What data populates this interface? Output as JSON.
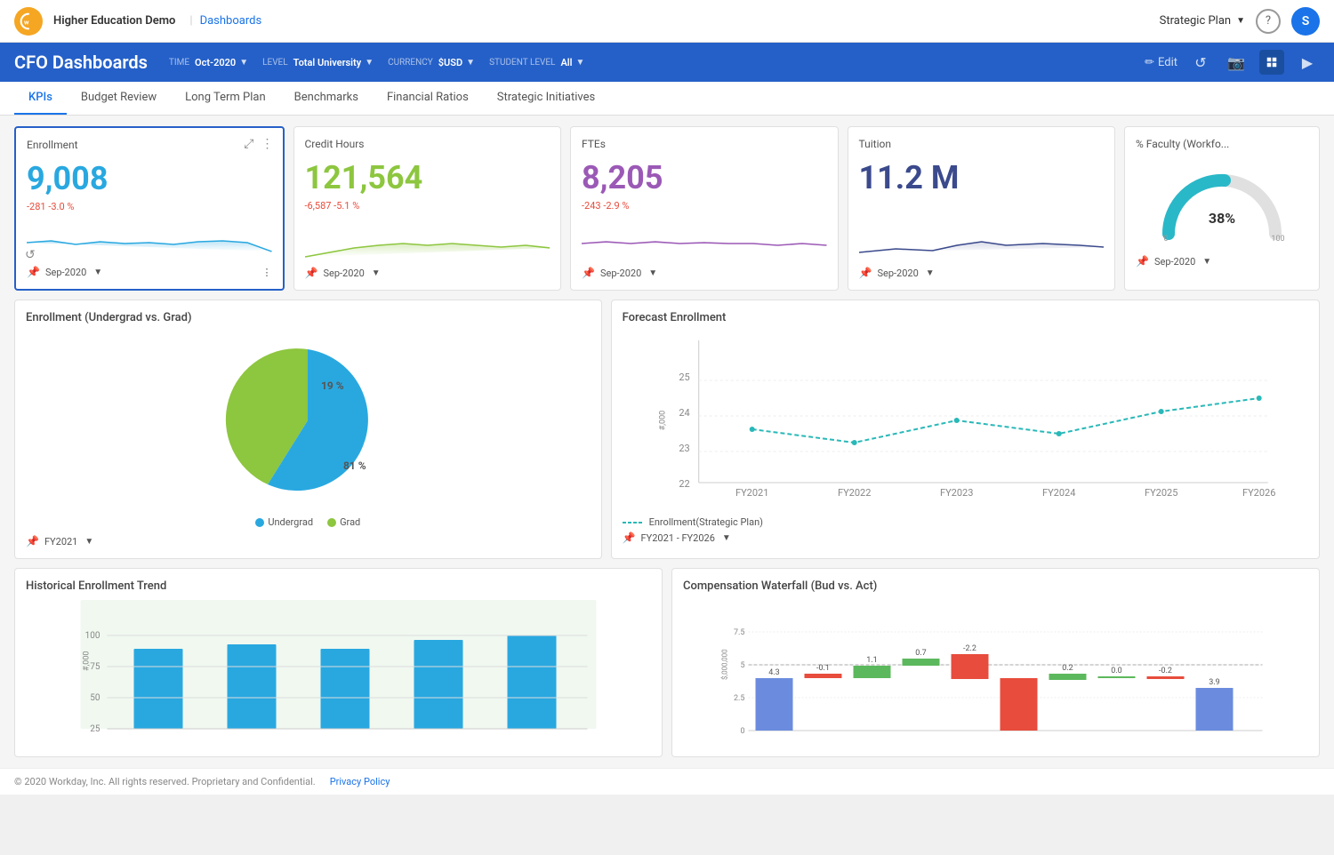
{
  "app": {
    "logo_letter": "W",
    "app_name": "Higher Education Demo",
    "separator": "|",
    "nav_link": "Dashboards",
    "strategic_plan_label": "Strategic Plan",
    "help_icon": "?",
    "avatar_letter": "S"
  },
  "header": {
    "title": "CFO Dashboards",
    "filters": [
      {
        "label": "TIME",
        "value": "Oct-2020",
        "id": "time-filter"
      },
      {
        "label": "LEVEL",
        "value": "Total University",
        "id": "level-filter"
      },
      {
        "label": "CURRENCY",
        "value": "$USD",
        "id": "currency-filter"
      },
      {
        "label": "STUDENT LEVEL",
        "value": "All",
        "id": "student-filter"
      }
    ],
    "edit_label": "Edit",
    "refresh_icon": "↺",
    "camera_icon": "📷",
    "grid_icon": "⊞",
    "video_icon": "▶"
  },
  "tabs": [
    {
      "label": "KPIs",
      "active": true
    },
    {
      "label": "Budget Review",
      "active": false
    },
    {
      "label": "Long Term Plan",
      "active": false
    },
    {
      "label": "Benchmarks",
      "active": false
    },
    {
      "label": "Financial Ratios",
      "active": false
    },
    {
      "label": "Strategic Initiatives",
      "active": false
    }
  ],
  "kpis": [
    {
      "title": "Enrollment",
      "value": "9,008",
      "value_color": "blue",
      "delta": "-281  -3.0 %",
      "footer_pin": "Sep-2020",
      "sparkline_color": "#29a8e0",
      "sparkline_fill": "rgba(41,168,224,0.1)"
    },
    {
      "title": "Credit Hours",
      "value": "121,564",
      "value_color": "green",
      "delta": "-6,587  -5.1 %",
      "footer_pin": "Sep-2020",
      "sparkline_color": "#8dc63f",
      "sparkline_fill": "rgba(141,198,63,0.1)"
    },
    {
      "title": "FTEs",
      "value": "8,205",
      "value_color": "purple",
      "delta": "-243  -2.9 %",
      "footer_pin": "Sep-2020",
      "sparkline_color": "#9b59b6",
      "sparkline_fill": "rgba(155,89,182,0.1)"
    },
    {
      "title": "Tuition",
      "value": "11.2 M",
      "value_color": "dark-blue",
      "delta": "",
      "footer_pin": "Sep-2020",
      "sparkline_color": "#3b4a8c",
      "sparkline_fill": "rgba(59,74,140,0.1)"
    },
    {
      "title": "% Faculty (Workfo...",
      "value": "",
      "value_color": "",
      "delta": "",
      "footer_pin": "Sep-2020",
      "gauge_pct": 38,
      "gauge_min": 0,
      "gauge_max": 100
    }
  ],
  "enrollment_pie": {
    "title": "Enrollment (Undergrad vs. Grad)",
    "undergrad_pct": 81,
    "grad_pct": 19,
    "undergrad_color": "#29a8e0",
    "grad_color": "#8dc63f",
    "undergrad_label": "Undergrad",
    "grad_label": "Grad",
    "footer_pin": "FY2021"
  },
  "forecast_enrollment": {
    "title": "Forecast Enrollment",
    "y_axis_labels": [
      "22",
      "23",
      "24",
      "25"
    ],
    "x_axis_labels": [
      "FY2021",
      "FY2022",
      "FY2023",
      "FY2024",
      "FY2025",
      "FY2026"
    ],
    "y_axis_unit": "#,000",
    "legend_label": "Enrollment(Strategic Plan)",
    "footer_pin": "FY2021 - FY2026",
    "line_color": "#29b8b8"
  },
  "historical_enrollment": {
    "title": "Historical Enrollment Trend",
    "y_axis_labels": [
      "25",
      "50",
      "75",
      "100"
    ],
    "y_axis_unit": "#,000",
    "bar_color": "#29a8e0",
    "bg_color": "#f0f8f0"
  },
  "compensation_waterfall": {
    "title": "Compensation Waterfall (Bud vs. Act)",
    "y_axis_labels": [
      "0",
      "2.5",
      "5",
      "7.5"
    ],
    "y_axis_unit": "$,000,000",
    "bars": [
      {
        "label": "",
        "value": 4.3,
        "color": "#6b8cde",
        "type": "base"
      },
      {
        "label": "",
        "value": -0.1,
        "color": "#e74c3c",
        "type": "negative"
      },
      {
        "label": "1.1",
        "value": 1.1,
        "color": "#5cb85c",
        "type": "positive"
      },
      {
        "label": "0.7",
        "value": 0.7,
        "color": "#5cb85c",
        "type": "positive"
      },
      {
        "label": "-2.2",
        "value": -2.2,
        "color": "#e74c3c",
        "type": "negative"
      },
      {
        "label": "",
        "value": 3.5,
        "color": "#e74c3c",
        "type": "red-base"
      },
      {
        "label": "0.2",
        "value": 0.2,
        "color": "#5cb85c",
        "type": "positive"
      },
      {
        "label": "0.0",
        "value": 0.0,
        "color": "#5cb85c",
        "type": "zero"
      },
      {
        "label": "-0.2",
        "value": -0.2,
        "color": "#e74c3c",
        "type": "negative"
      },
      {
        "label": "3.9",
        "value": 3.9,
        "color": "#6b8cde",
        "type": "base"
      }
    ]
  },
  "footer": {
    "copyright": "© 2020 Workday, Inc. All rights reserved. Proprietary and Confidential.",
    "privacy_label": "Privacy Policy"
  }
}
